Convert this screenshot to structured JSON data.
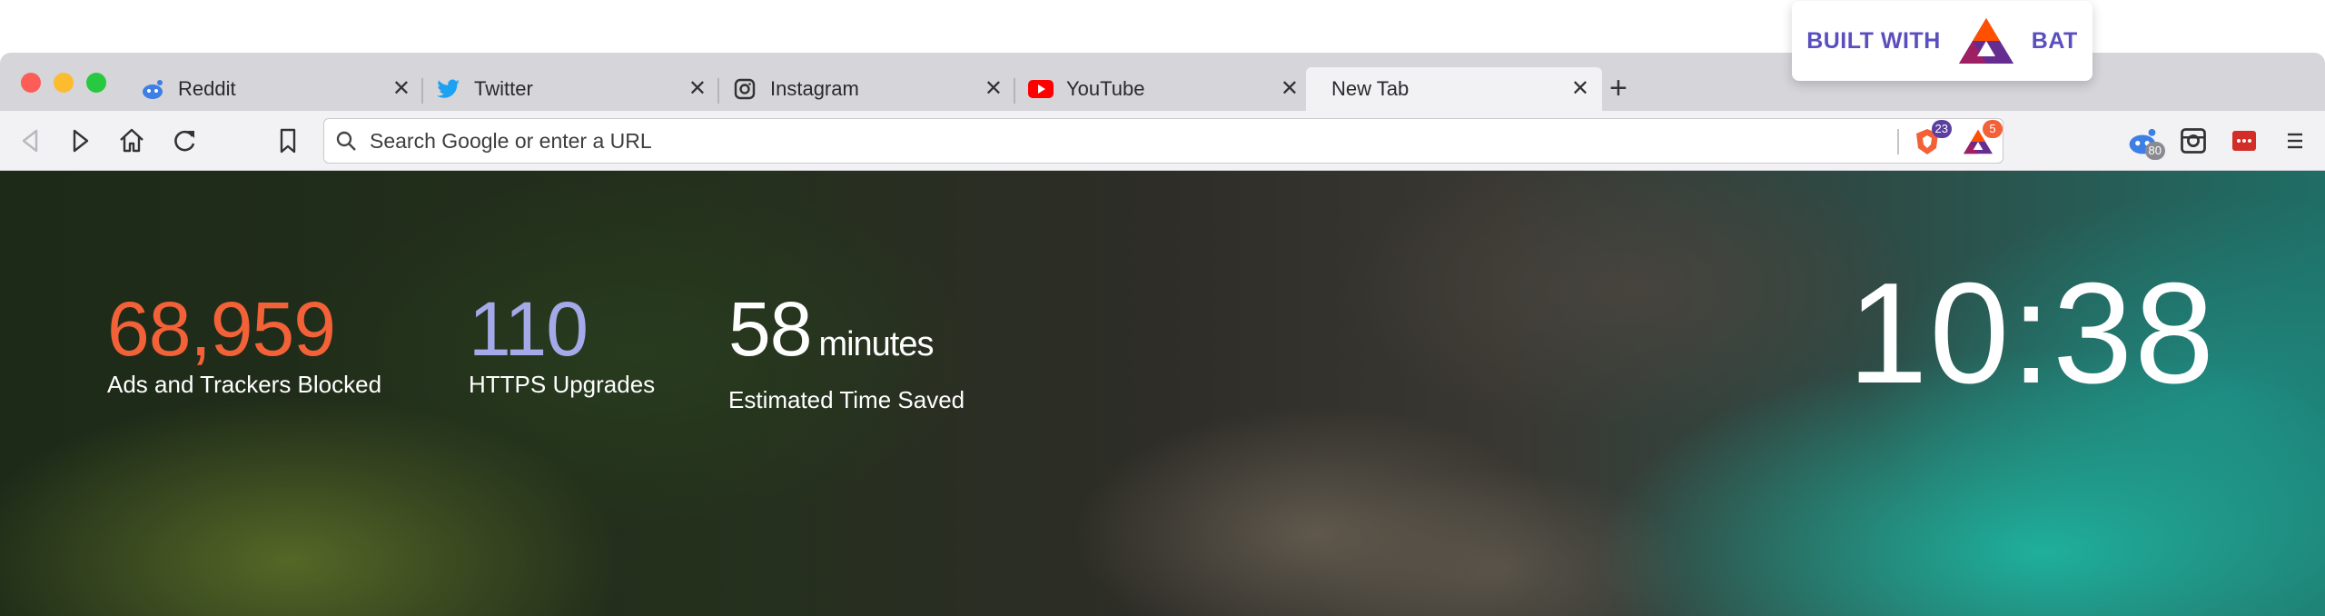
{
  "badge": {
    "text_left": "BUILT WITH",
    "text_right": "BAT"
  },
  "colors": {
    "reddit": "#3e7fe6",
    "twitter": "#1da1f2",
    "youtube": "#ff0000",
    "ads": "#f26138",
    "https": "#a4a9e8",
    "bat_purple": "#5a4fbf"
  },
  "tabs": [
    {
      "label": "Reddit",
      "icon": "reddit-icon"
    },
    {
      "label": "Twitter",
      "icon": "twitter-icon"
    },
    {
      "label": "Instagram",
      "icon": "instagram-icon"
    },
    {
      "label": "YouTube",
      "icon": "youtube-icon"
    },
    {
      "label": "New Tab",
      "icon": ""
    }
  ],
  "urlbar": {
    "placeholder": "Search Google or enter a URL"
  },
  "extensions": {
    "brave_count": "23",
    "bat_count": "5",
    "reddit_count": "80"
  },
  "stats": {
    "ads": {
      "value": "68,959",
      "label": "Ads and Trackers Blocked"
    },
    "https": {
      "value": "110",
      "label": "HTTPS Upgrades"
    },
    "time": {
      "value": "58",
      "unit": "minutes",
      "label": "Estimated Time Saved"
    }
  },
  "clock": "10:38"
}
